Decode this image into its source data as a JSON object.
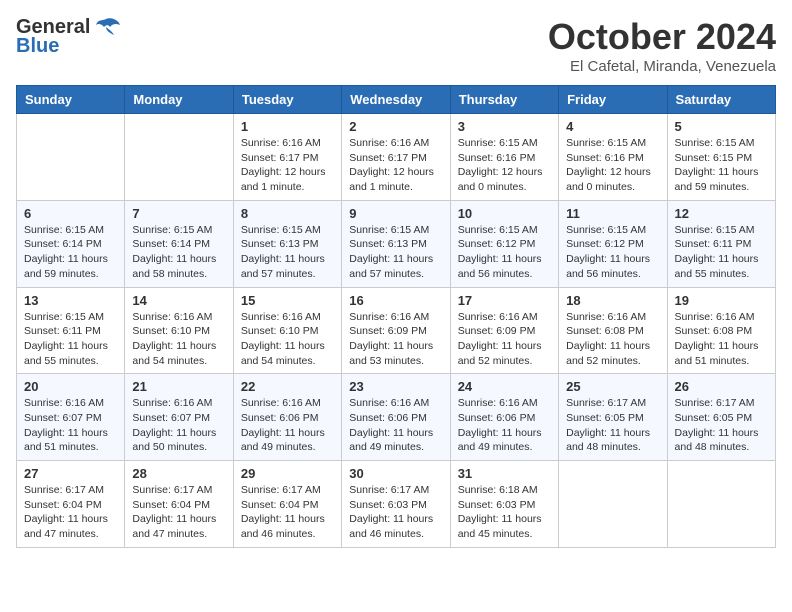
{
  "header": {
    "logo_general": "General",
    "logo_blue": "Blue",
    "month_title": "October 2024",
    "location": "El Cafetal, Miranda, Venezuela"
  },
  "weekdays": [
    "Sunday",
    "Monday",
    "Tuesday",
    "Wednesday",
    "Thursday",
    "Friday",
    "Saturday"
  ],
  "weeks": [
    [
      {
        "day": "",
        "info": ""
      },
      {
        "day": "",
        "info": ""
      },
      {
        "day": "1",
        "info": "Sunrise: 6:16 AM\nSunset: 6:17 PM\nDaylight: 12 hours and 1 minute."
      },
      {
        "day": "2",
        "info": "Sunrise: 6:16 AM\nSunset: 6:17 PM\nDaylight: 12 hours and 1 minute."
      },
      {
        "day": "3",
        "info": "Sunrise: 6:15 AM\nSunset: 6:16 PM\nDaylight: 12 hours and 0 minutes."
      },
      {
        "day": "4",
        "info": "Sunrise: 6:15 AM\nSunset: 6:16 PM\nDaylight: 12 hours and 0 minutes."
      },
      {
        "day": "5",
        "info": "Sunrise: 6:15 AM\nSunset: 6:15 PM\nDaylight: 11 hours and 59 minutes."
      }
    ],
    [
      {
        "day": "6",
        "info": "Sunrise: 6:15 AM\nSunset: 6:14 PM\nDaylight: 11 hours and 59 minutes."
      },
      {
        "day": "7",
        "info": "Sunrise: 6:15 AM\nSunset: 6:14 PM\nDaylight: 11 hours and 58 minutes."
      },
      {
        "day": "8",
        "info": "Sunrise: 6:15 AM\nSunset: 6:13 PM\nDaylight: 11 hours and 57 minutes."
      },
      {
        "day": "9",
        "info": "Sunrise: 6:15 AM\nSunset: 6:13 PM\nDaylight: 11 hours and 57 minutes."
      },
      {
        "day": "10",
        "info": "Sunrise: 6:15 AM\nSunset: 6:12 PM\nDaylight: 11 hours and 56 minutes."
      },
      {
        "day": "11",
        "info": "Sunrise: 6:15 AM\nSunset: 6:12 PM\nDaylight: 11 hours and 56 minutes."
      },
      {
        "day": "12",
        "info": "Sunrise: 6:15 AM\nSunset: 6:11 PM\nDaylight: 11 hours and 55 minutes."
      }
    ],
    [
      {
        "day": "13",
        "info": "Sunrise: 6:15 AM\nSunset: 6:11 PM\nDaylight: 11 hours and 55 minutes."
      },
      {
        "day": "14",
        "info": "Sunrise: 6:16 AM\nSunset: 6:10 PM\nDaylight: 11 hours and 54 minutes."
      },
      {
        "day": "15",
        "info": "Sunrise: 6:16 AM\nSunset: 6:10 PM\nDaylight: 11 hours and 54 minutes."
      },
      {
        "day": "16",
        "info": "Sunrise: 6:16 AM\nSunset: 6:09 PM\nDaylight: 11 hours and 53 minutes."
      },
      {
        "day": "17",
        "info": "Sunrise: 6:16 AM\nSunset: 6:09 PM\nDaylight: 11 hours and 52 minutes."
      },
      {
        "day": "18",
        "info": "Sunrise: 6:16 AM\nSunset: 6:08 PM\nDaylight: 11 hours and 52 minutes."
      },
      {
        "day": "19",
        "info": "Sunrise: 6:16 AM\nSunset: 6:08 PM\nDaylight: 11 hours and 51 minutes."
      }
    ],
    [
      {
        "day": "20",
        "info": "Sunrise: 6:16 AM\nSunset: 6:07 PM\nDaylight: 11 hours and 51 minutes."
      },
      {
        "day": "21",
        "info": "Sunrise: 6:16 AM\nSunset: 6:07 PM\nDaylight: 11 hours and 50 minutes."
      },
      {
        "day": "22",
        "info": "Sunrise: 6:16 AM\nSunset: 6:06 PM\nDaylight: 11 hours and 49 minutes."
      },
      {
        "day": "23",
        "info": "Sunrise: 6:16 AM\nSunset: 6:06 PM\nDaylight: 11 hours and 49 minutes."
      },
      {
        "day": "24",
        "info": "Sunrise: 6:16 AM\nSunset: 6:06 PM\nDaylight: 11 hours and 49 minutes."
      },
      {
        "day": "25",
        "info": "Sunrise: 6:17 AM\nSunset: 6:05 PM\nDaylight: 11 hours and 48 minutes."
      },
      {
        "day": "26",
        "info": "Sunrise: 6:17 AM\nSunset: 6:05 PM\nDaylight: 11 hours and 48 minutes."
      }
    ],
    [
      {
        "day": "27",
        "info": "Sunrise: 6:17 AM\nSunset: 6:04 PM\nDaylight: 11 hours and 47 minutes."
      },
      {
        "day": "28",
        "info": "Sunrise: 6:17 AM\nSunset: 6:04 PM\nDaylight: 11 hours and 47 minutes."
      },
      {
        "day": "29",
        "info": "Sunrise: 6:17 AM\nSunset: 6:04 PM\nDaylight: 11 hours and 46 minutes."
      },
      {
        "day": "30",
        "info": "Sunrise: 6:17 AM\nSunset: 6:03 PM\nDaylight: 11 hours and 46 minutes."
      },
      {
        "day": "31",
        "info": "Sunrise: 6:18 AM\nSunset: 6:03 PM\nDaylight: 11 hours and 45 minutes."
      },
      {
        "day": "",
        "info": ""
      },
      {
        "day": "",
        "info": ""
      }
    ]
  ]
}
